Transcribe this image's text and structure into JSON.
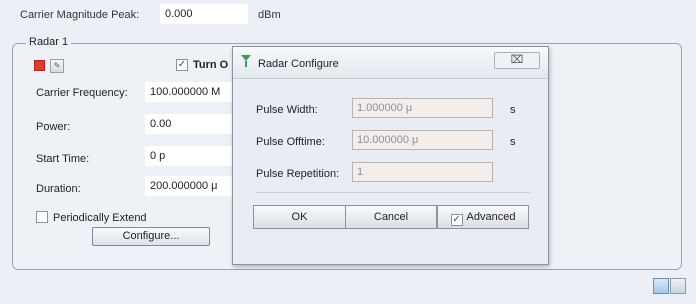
{
  "carrier": {
    "label": "Carrier Magnitude Peak:",
    "value": "0.000",
    "unit": "dBm"
  },
  "radar": {
    "group_title": "Radar 1",
    "turn_label": "Turn O",
    "rows": [
      {
        "label": "Carrier Frequency:",
        "value": "100.000000 M"
      },
      {
        "label": "Power:",
        "value": "0.00"
      },
      {
        "label": "Start Time:",
        "value": "0 p"
      },
      {
        "label": "Duration:",
        "value": "200.000000 μ"
      }
    ],
    "periodic_label": "Periodically Extend",
    "configure_label": "Configure..."
  },
  "dialog": {
    "title": "Radar Configure",
    "close_glyph": "⌧",
    "fields": [
      {
        "label": "Pulse Width:",
        "value": "1.000000 μ",
        "unit": "s"
      },
      {
        "label": "Pulse Offtime:",
        "value": "10.000000 μ",
        "unit": "s"
      },
      {
        "label": "Pulse Repetition:",
        "value": "1",
        "unit": ""
      }
    ],
    "ok_label": "OK",
    "cancel_label": "Cancel",
    "advanced_label": "Advanced"
  },
  "colors": {
    "record": "#e23a2d",
    "accent": "#2a4d8a"
  }
}
